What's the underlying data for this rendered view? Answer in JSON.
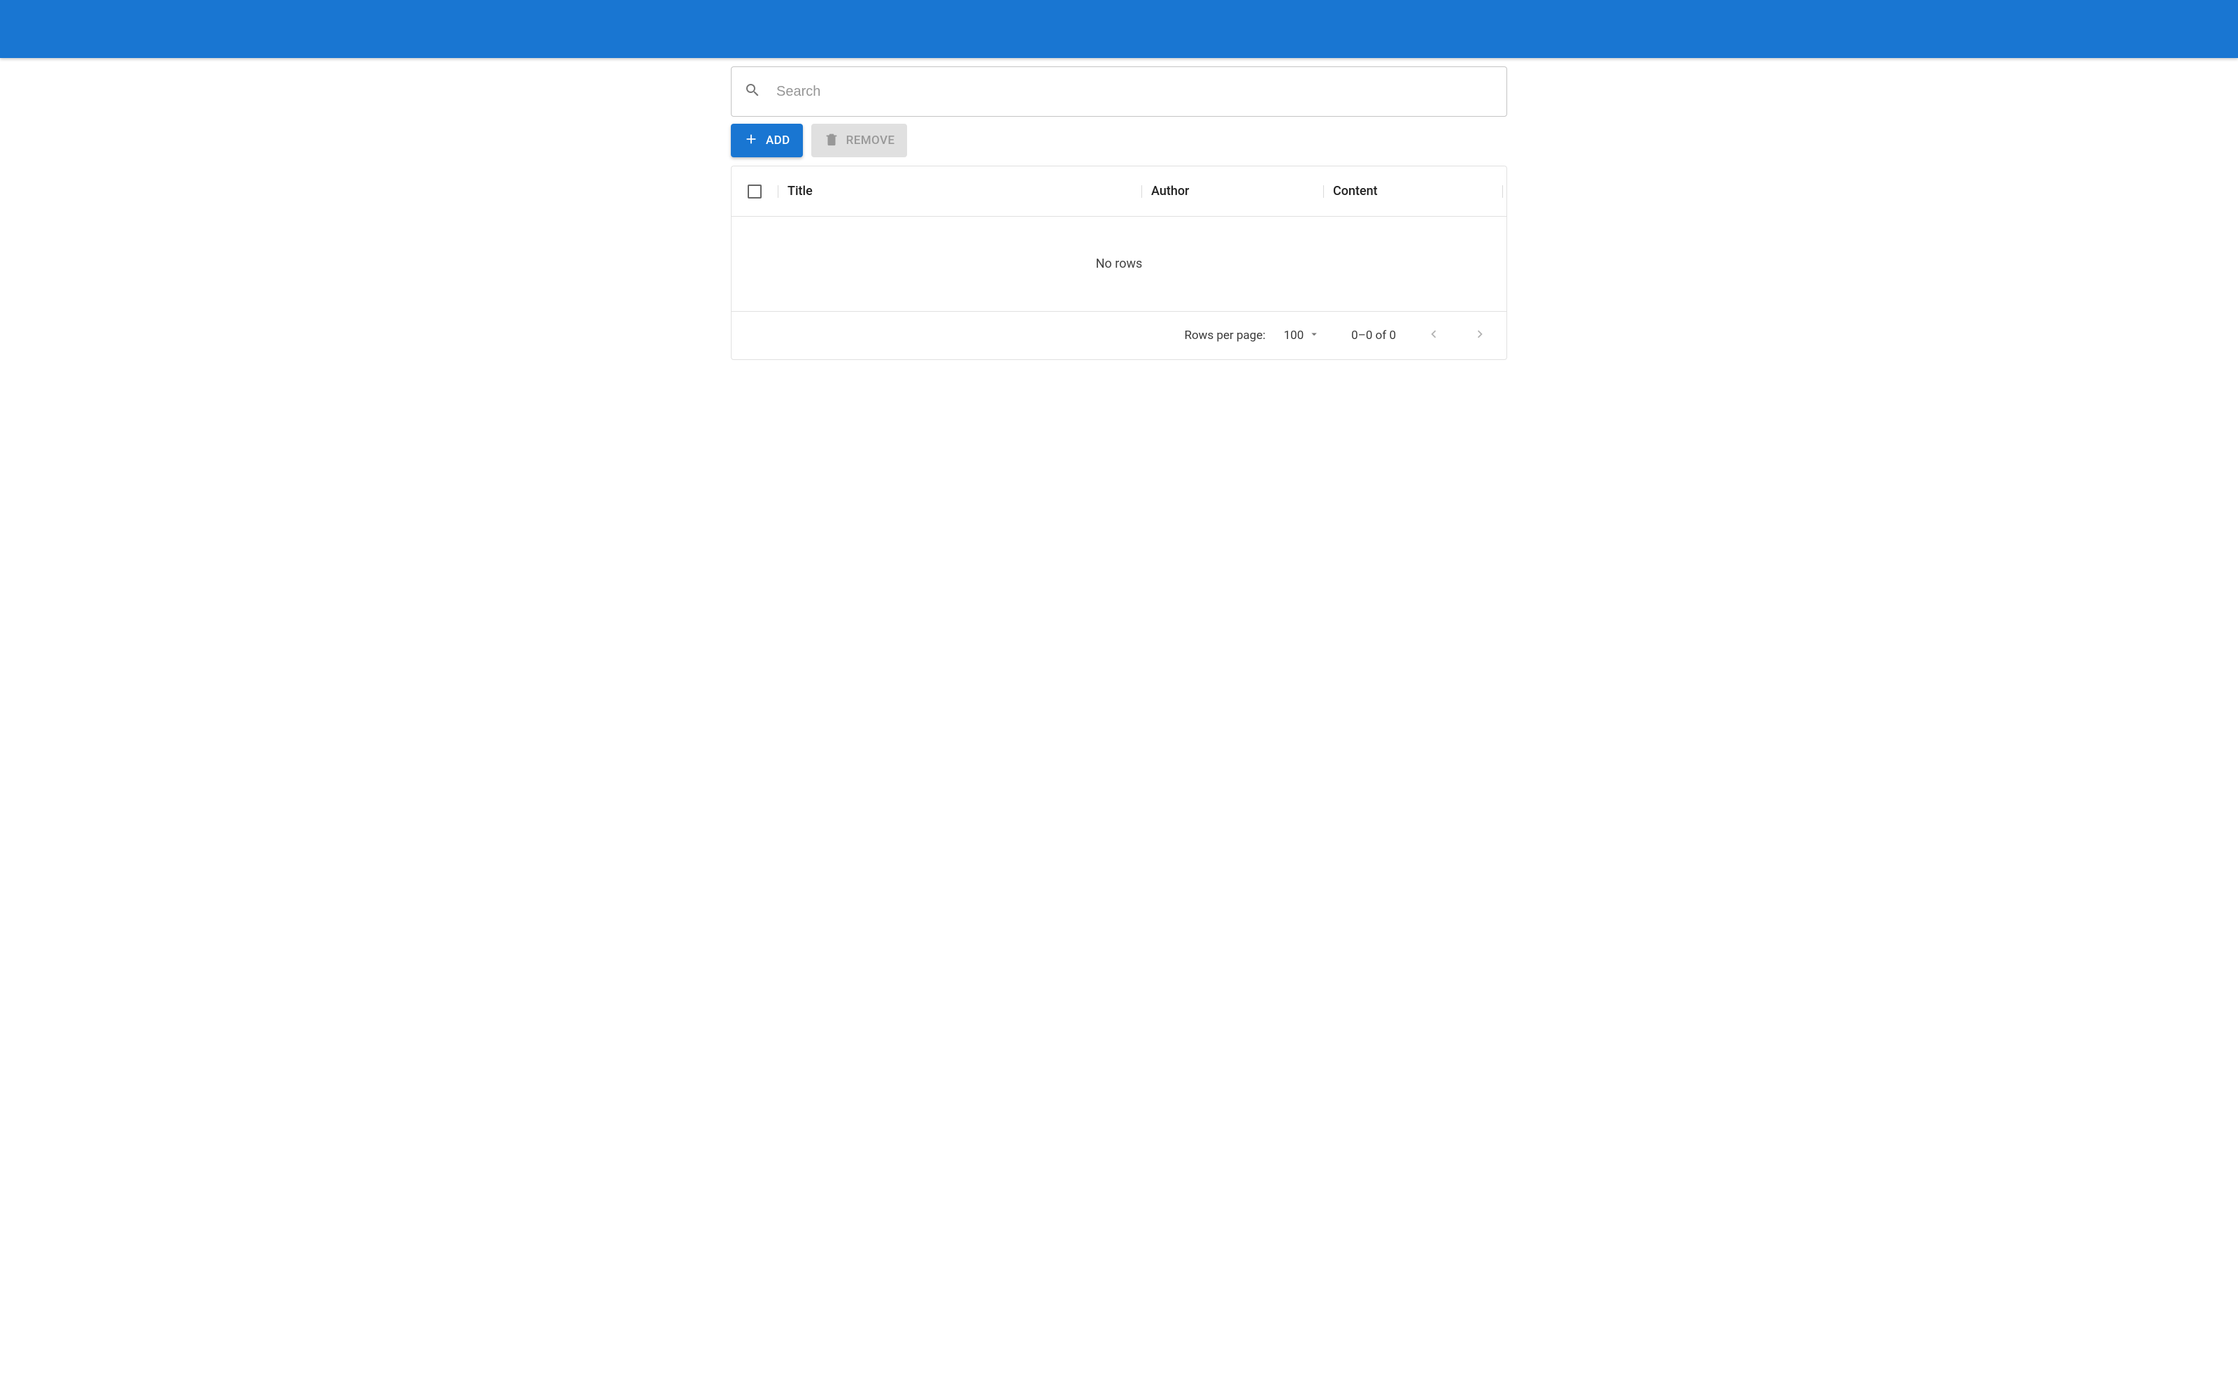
{
  "search": {
    "placeholder": "Search",
    "value": ""
  },
  "toolbar": {
    "add_label": "Add",
    "remove_label": "Remove"
  },
  "grid": {
    "columns": {
      "title": "Title",
      "author": "Author",
      "content": "Content"
    },
    "empty_text": "No rows",
    "rows": []
  },
  "pagination": {
    "rows_per_page_label": "Rows per page:",
    "page_size": "100",
    "range_text": "0–0 of 0"
  }
}
